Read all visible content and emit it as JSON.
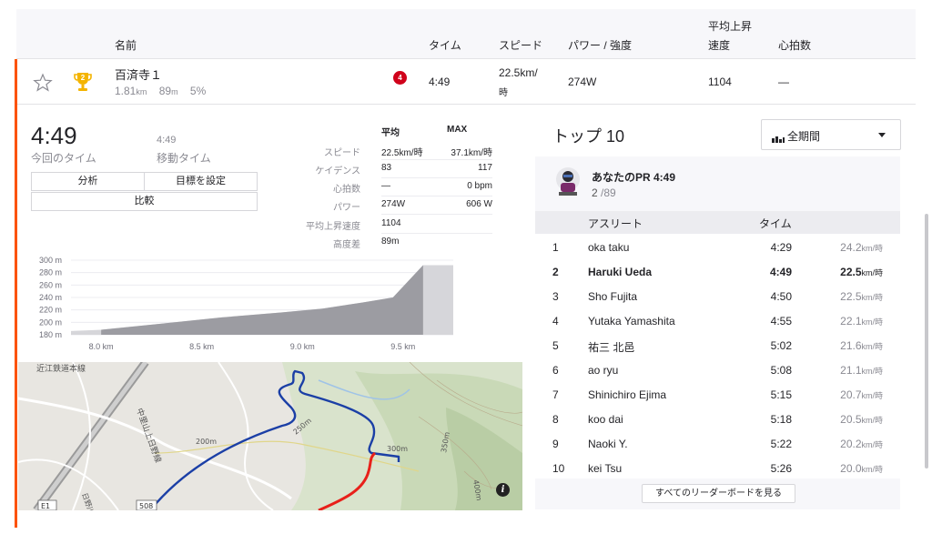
{
  "header": {
    "name": "名前",
    "time": "タイム",
    "speed": "スピード",
    "power": "パワー / 強度",
    "vam_line1": "平均上昇",
    "vam_line2": "速度",
    "heart": "心拍数"
  },
  "segment": {
    "name": "百済寺１",
    "distance": "1.81",
    "distance_unit": "km",
    "elev": "89",
    "elev_unit": "m",
    "grade": "5%",
    "badge": "4",
    "trophy_rank": "2",
    "time": "4:49",
    "speed": "22.5km/",
    "speed_unit": "時",
    "power": "274W",
    "vam": "1104",
    "heart": "—"
  },
  "detail": {
    "current_time": "4:49",
    "current_time_label": "今回のタイム",
    "moving_time": "4:49",
    "moving_time_label": "移動タイム",
    "btn_analysis": "分析",
    "btn_goal": "目標を設定",
    "btn_compare": "比較",
    "stats_head_avg": "平均",
    "stats_head_max": "MAX",
    "stats": [
      {
        "label": "スピード",
        "avg": "22.5km/時",
        "max": "37.1km/時"
      },
      {
        "label": "ケイデンス",
        "avg": "83",
        "max": "117"
      },
      {
        "label": "心拍数",
        "avg": "—",
        "max": "0 bpm"
      },
      {
        "label": "パワー",
        "avg": "274W",
        "max": "606 W"
      },
      {
        "label": "平均上昇速度",
        "avg": "1104",
        "max": ""
      },
      {
        "label": "高度差",
        "avg": "89m",
        "max": ""
      }
    ]
  },
  "chart_data": {
    "type": "area",
    "title": "",
    "xlabel": "",
    "ylabel": "",
    "x_ticks": [
      "8.0 km",
      "8.5 km",
      "9.0 km",
      "9.5 km"
    ],
    "y_ticks": [
      "300 m",
      "280 m",
      "260 m",
      "240 m",
      "220 m",
      "200 m",
      "180 m"
    ],
    "xlim": [
      7.85,
      9.75
    ],
    "ylim": [
      180,
      300
    ],
    "x": [
      7.85,
      8.0,
      8.3,
      8.6,
      8.9,
      9.1,
      9.3,
      9.45,
      9.6,
      9.7,
      9.75
    ],
    "y": [
      186,
      188,
      198,
      208,
      216,
      222,
      232,
      240,
      292,
      292,
      292
    ],
    "highlight_range": [
      8.0,
      9.6
    ],
    "grid": true,
    "colors": {
      "fill": "#9c9ca2",
      "fill_outside": "#d6d6da"
    }
  },
  "map": {
    "labels": [
      "近江鉄道本線",
      "中里山上日野線",
      "200m",
      "250m",
      "300m",
      "350m",
      "400m",
      "日野川",
      "E1",
      "508"
    ],
    "info_icon": "info-icon",
    "route_color": "#1b3fa6",
    "segment_color": "#e8201a"
  },
  "leaderboard": {
    "title": "トップ 10",
    "filter_label": "全期間",
    "pr_label": "あなたのPR 4:49",
    "pr_rank": "2",
    "pr_total": "/89",
    "col_athlete": "アスリート",
    "col_time": "タイム",
    "rows": [
      {
        "rank": "1",
        "name": "oka taku",
        "time": "4:29",
        "speed": "24.2",
        "unit": "km/時",
        "me": false
      },
      {
        "rank": "2",
        "name": "Haruki Ueda",
        "time": "4:49",
        "speed": "22.5",
        "unit": "km/時",
        "me": true
      },
      {
        "rank": "3",
        "name": "Sho Fujita",
        "time": "4:50",
        "speed": "22.5",
        "unit": "km/時",
        "me": false
      },
      {
        "rank": "4",
        "name": "Yutaka Yamashita",
        "time": "4:55",
        "speed": "22.1",
        "unit": "km/時",
        "me": false
      },
      {
        "rank": "5",
        "name": "祐三 北邑",
        "time": "5:02",
        "speed": "21.6",
        "unit": "km/時",
        "me": false
      },
      {
        "rank": "6",
        "name": "ao ryu",
        "time": "5:08",
        "speed": "21.1",
        "unit": "km/時",
        "me": false
      },
      {
        "rank": "7",
        "name": "Shinichiro Ejima",
        "time": "5:15",
        "speed": "20.7",
        "unit": "km/時",
        "me": false
      },
      {
        "rank": "8",
        "name": "koo dai",
        "time": "5:18",
        "speed": "20.5",
        "unit": "km/時",
        "me": false
      },
      {
        "rank": "9",
        "name": "Naoki Y.",
        "time": "5:22",
        "speed": "20.2",
        "unit": "km/時",
        "me": false
      },
      {
        "rank": "10",
        "name": "kei Tsu",
        "time": "5:26",
        "speed": "20.0",
        "unit": "km/時",
        "me": false
      }
    ],
    "view_all": "すべてのリーダーボードを見る"
  }
}
